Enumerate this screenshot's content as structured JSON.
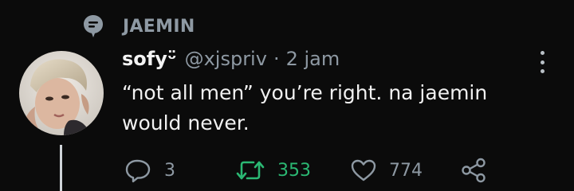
{
  "topic": {
    "label": "JAEMIN",
    "icon": "topic-bubble-icon"
  },
  "tweet": {
    "author": {
      "display_name": "sofyᵕ̈",
      "handle": "@xjspriv",
      "avatar_icon": "avatar-photo"
    },
    "separator": "·",
    "timestamp": "2 jam",
    "text": "“not all men” you’re right. na jaemin would never.",
    "actions": {
      "reply": {
        "icon": "reply-icon",
        "count": "3"
      },
      "retweet": {
        "icon": "retweet-icon",
        "count": "353",
        "color": "#2bb873"
      },
      "like": {
        "icon": "heart-icon",
        "count": "774"
      },
      "share": {
        "icon": "share-icon"
      }
    }
  },
  "colors": {
    "background": "#0b0b0b",
    "muted_text": "#8e99a3",
    "primary_text": "#f1f1f1",
    "retweet_active": "#2bb873"
  }
}
